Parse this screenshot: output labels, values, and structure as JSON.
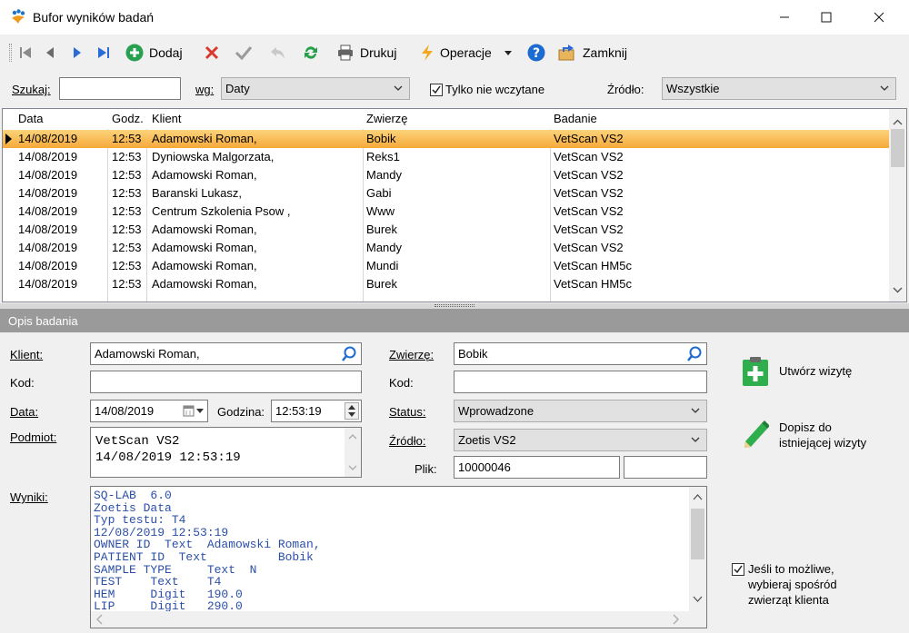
{
  "window": {
    "title": "Bufor wyników badań"
  },
  "toolbar": {
    "add_label": "Dodaj",
    "print_label": "Drukuj",
    "operations_label": "Operacje",
    "close_label": "Zamknij"
  },
  "search": {
    "search_label": "Szukaj:",
    "search_value": "",
    "by_label": "wg:",
    "by_value": "Daty",
    "unread_label": "Tylko nie wczytane",
    "unread_checked": true,
    "source_label": "Źródło:",
    "source_value": "Wszystkie"
  },
  "grid": {
    "columns": [
      "Data",
      "Godz.",
      "Klient",
      "Zwierzę",
      "Badanie"
    ],
    "rows": [
      [
        "14/08/2019",
        "12:53",
        "Adamowski Roman,",
        "Bobik",
        "VetScan VS2"
      ],
      [
        "14/08/2019",
        "12:53",
        "Dyniowska Malgorzata,",
        "Reks1",
        "VetScan VS2"
      ],
      [
        "14/08/2019",
        "12:53",
        "Adamowski Roman,",
        "Mandy",
        "VetScan VS2"
      ],
      [
        "14/08/2019",
        "12:53",
        "Baranski Lukasz,",
        "Gabi",
        "VetScan VS2"
      ],
      [
        "14/08/2019",
        "12:53",
        "Centrum Szkolenia Psow ,",
        "Www",
        "VetScan VS2"
      ],
      [
        "14/08/2019",
        "12:53",
        "Adamowski Roman,",
        "Burek",
        "VetScan VS2"
      ],
      [
        "14/08/2019",
        "12:53",
        "Adamowski Roman,",
        "Mandy",
        "VetScan VS2"
      ],
      [
        "14/08/2019",
        "12:53",
        "Adamowski Roman,",
        "Mundi",
        "VetScan HM5c"
      ],
      [
        "14/08/2019",
        "12:53",
        "Adamowski Roman,",
        "Burek",
        "VetScan HM5c"
      ]
    ]
  },
  "detail": {
    "section_title": "Opis badania",
    "client_label": "Klient:",
    "client_value": "Adamowski Roman,",
    "code_label": "Kod:",
    "code_value": "",
    "date_label": "Data:",
    "date_value": "14/08/2019",
    "time_label": "Godzina:",
    "time_value": "12:53:19",
    "subject_label": "Podmiot:",
    "subject_value": "VetScan VS2\n14/08/2019 12:53:19",
    "results_label": "Wyniki:",
    "results_value": "SQ-LAB  6.0\nZoetis Data\nTyp testu: T4\n12/08/2019 12:53:19\nOWNER ID  Text  Adamowski Roman,\nPATIENT ID  Text          Bobik\nSAMPLE TYPE     Text  N\nTEST    Text    T4\nHEM     Digit   190.0\nLIP     Digit   290.0",
    "animal_label": "Zwierzę:",
    "animal_value": "Bobik",
    "animal_code_label": "Kod:",
    "animal_code_value": "",
    "status_label": "Status:",
    "status_value": "Wprowadzone",
    "source_label": "Źródło:",
    "source_value": "Zoetis VS2",
    "file_label": "Plik:",
    "file_value": "10000046",
    "file_value2": ""
  },
  "actions": {
    "create_visit": "Utwórz wizytę",
    "append_visit_1": "Dopisz do",
    "append_visit_2": "istniejącej wizyty",
    "prefer_client_animals_1": "Jeśli to możliwe,",
    "prefer_client_animals_2": "wybieraj spośród",
    "prefer_client_animals_3": "zwierząt klienta",
    "prefer_client_animals_checked": true
  }
}
